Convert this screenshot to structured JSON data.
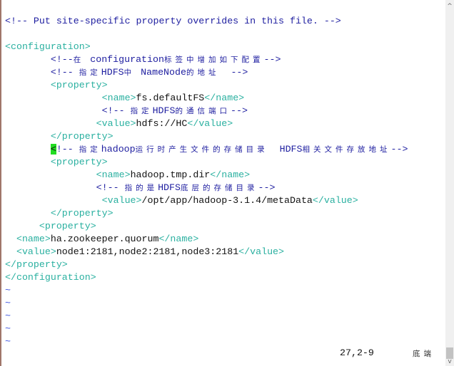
{
  "editor": {
    "lines": [
      [
        {
          "t": "<!-- Put site-specific property overrides in this file. -->",
          "k": "c"
        }
      ],
      [],
      [
        {
          "t": "<configuration>",
          "k": "t"
        }
      ],
      [
        {
          "t": "        <!--",
          "k": "c"
        },
        {
          "t": "在",
          "k": "cz"
        },
        {
          "t": " configuration",
          "k": "c"
        },
        {
          "t": "标签中增加如下配置",
          "k": "cz"
        },
        {
          "t": "-->",
          "k": "c"
        }
      ],
      [
        {
          "t": "        <!-- ",
          "k": "c"
        },
        {
          "t": "指定",
          "k": "cz"
        },
        {
          "t": "HDFS",
          "k": "c"
        },
        {
          "t": "中",
          "k": "cz"
        },
        {
          "t": " NameNode",
          "k": "c"
        },
        {
          "t": "的地址",
          "k": "cz"
        },
        {
          "t": "  -->",
          "k": "c"
        }
      ],
      [
        {
          "t": "        <property>",
          "k": "t"
        }
      ],
      [
        {
          "t": "                 <name>",
          "k": "t"
        },
        {
          "t": "fs.defaultFS",
          "k": "n"
        },
        {
          "t": "</name>",
          "k": "t"
        }
      ],
      [
        {
          "t": "                 <!-- ",
          "k": "c"
        },
        {
          "t": "指定",
          "k": "cz"
        },
        {
          "t": "HDFS",
          "k": "c"
        },
        {
          "t": "的通信端口",
          "k": "cz"
        },
        {
          "t": "-->",
          "k": "c"
        }
      ],
      [
        {
          "t": "                <value>",
          "k": "t"
        },
        {
          "t": "hdfs://HC",
          "k": "n"
        },
        {
          "t": "</value>",
          "k": "t"
        }
      ],
      [
        {
          "t": "        </property>",
          "k": "t"
        }
      ],
      [
        {
          "t": "        ",
          "k": "c"
        },
        {
          "t": "<",
          "k": "cur"
        },
        {
          "t": "!-- ",
          "k": "c"
        },
        {
          "t": "指定",
          "k": "cz"
        },
        {
          "t": "hadoop",
          "k": "c"
        },
        {
          "t": "运行时产生文件的存储目录",
          "k": "cz"
        },
        {
          "t": "  HDFS",
          "k": "c"
        },
        {
          "t": "相关文件存放地址",
          "k": "cz"
        },
        {
          "t": "-->",
          "k": "c"
        }
      ],
      [
        {
          "t": "        <property>",
          "k": "t"
        }
      ],
      [
        {
          "t": "                <name>",
          "k": "t"
        },
        {
          "t": "hadoop.tmp.dir",
          "k": "n"
        },
        {
          "t": "</name>",
          "k": "t"
        }
      ],
      [
        {
          "t": "                <!-- ",
          "k": "c"
        },
        {
          "t": "指的是",
          "k": "cz"
        },
        {
          "t": "HDFS",
          "k": "c"
        },
        {
          "t": "底层的存储目录",
          "k": "cz"
        },
        {
          "t": "-->",
          "k": "c"
        }
      ],
      [
        {
          "t": "                 <value>",
          "k": "t"
        },
        {
          "t": "/opt/app/hadoop-3.1.4/metaData",
          "k": "n"
        },
        {
          "t": "</value>",
          "k": "t"
        }
      ],
      [
        {
          "t": "        </property>",
          "k": "t"
        }
      ],
      [
        {
          "t": "      <property>",
          "k": "t"
        }
      ],
      [
        {
          "t": "  <name>",
          "k": "t"
        },
        {
          "t": "ha.zookeeper.quorum",
          "k": "n"
        },
        {
          "t": "</name>",
          "k": "t"
        }
      ],
      [
        {
          "t": "  <value>",
          "k": "t"
        },
        {
          "t": "node1:2181,node2:2181,node3:2181",
          "k": "n"
        },
        {
          "t": "</value>",
          "k": "t"
        }
      ],
      [
        {
          "t": "</property>",
          "k": "t"
        }
      ],
      [
        {
          "t": "</configuration>",
          "k": "t"
        }
      ],
      [
        {
          "t": "~",
          "k": "tl"
        }
      ],
      [
        {
          "t": "~",
          "k": "tl"
        }
      ],
      [
        {
          "t": "~",
          "k": "tl"
        }
      ],
      [
        {
          "t": "~",
          "k": "tl"
        }
      ],
      [
        {
          "t": "~",
          "k": "tl"
        }
      ]
    ],
    "cursor_color": "#22dd22"
  },
  "status": {
    "position": "27,2-9",
    "scroll": "底端"
  },
  "scrollbar": {
    "up_icon": "^",
    "down_icon": "v"
  },
  "colors": {
    "comment": "#1e1ea0",
    "tag": "#2ab0a0",
    "text": "#111111",
    "tilde": "#3a50e0"
  }
}
